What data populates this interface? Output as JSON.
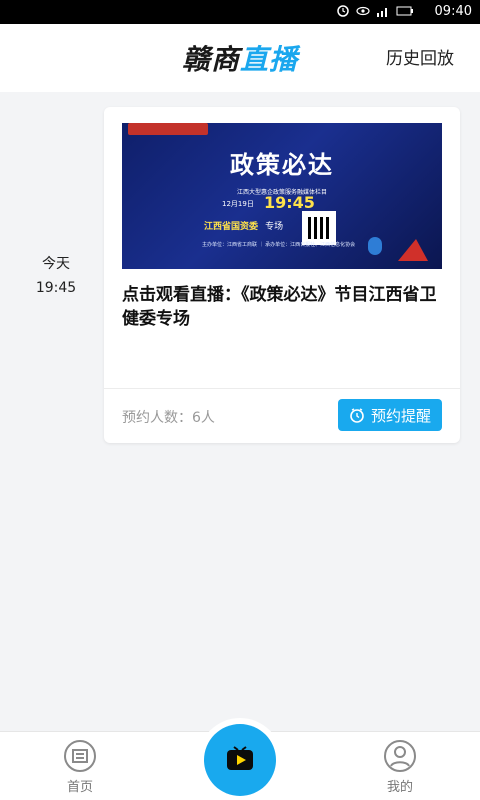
{
  "status_bar": {
    "time": "09:40",
    "battery": "40"
  },
  "header": {
    "logo_part1": "赣商",
    "logo_part2": "直播",
    "history_label": "历史回放"
  },
  "date_group": {
    "day_label": "今天",
    "time_label": "19:45"
  },
  "card": {
    "banner": {
      "title": "政策必达",
      "subtitle": "江西大型惠企政策服务融媒体栏目",
      "date": "12月19日",
      "time": "19:45",
      "department": "江西省国资委",
      "department_suffix": "专场",
      "small_text": "主办单位：江西省工商联 ｜ 承办单位：江西日报社、江西信息化协会",
      "brand_color": "#0f1f6a",
      "accent_color": "#ffe24a"
    },
    "title": "点击观看直播：《政策必达》节目江西省卫健委专场",
    "reservation_text": "预约人数：6人",
    "remind_button_label": "预约提醒"
  },
  "bottom_nav": {
    "home_label": "首页",
    "me_label": "我的"
  },
  "colors": {
    "accent": "#19a9ee"
  }
}
